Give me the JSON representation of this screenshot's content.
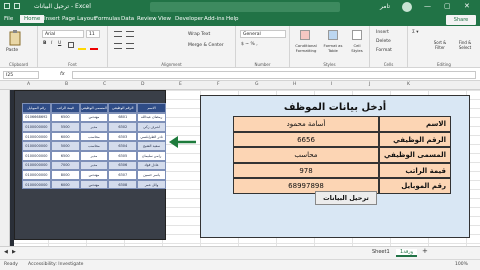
{
  "window": {
    "title_doc": "ترحيل البيانات - Excel",
    "user": "تامر",
    "min": "—",
    "max": "▢",
    "close": "✕"
  },
  "tabs": [
    "File",
    "Home",
    "Insert",
    "Page Layout",
    "Formulas",
    "Data",
    "Review",
    "View",
    "Developer",
    "Add-ins",
    "Help"
  ],
  "share": "Share",
  "ribbon": {
    "clipboard": {
      "paste": "Paste",
      "label": "Clipboard"
    },
    "font": {
      "name": "Arial",
      "size": "11",
      "label": "Font"
    },
    "alignment": {
      "wrap": "Wrap Text",
      "merge": "Merge & Center",
      "label": "Alignment"
    },
    "number": {
      "format": "General",
      "label": "Number"
    },
    "styles": {
      "cond": "Conditional Formatting",
      "table": "Format as Table",
      "cell": "Cell Styles",
      "label": "Styles"
    },
    "cells": {
      "insert": "Insert",
      "delete": "Delete",
      "format": "Format",
      "label": "Cells"
    },
    "editing": {
      "sort": "Sort & Filter",
      "find": "Find & Select",
      "label": "Editing"
    }
  },
  "formula_bar": {
    "namebox": "I25",
    "fx": "fx",
    "content": ""
  },
  "columns": [
    "A",
    "B",
    "C",
    "D",
    "E",
    "F",
    "G",
    "H",
    "I",
    "J",
    "K"
  ],
  "data_table": {
    "headers": [
      "رقم الموبايل",
      "قيمة الراتب",
      "المسمى الوظيفي",
      "الرقم الوظيفي",
      "الاسم"
    ],
    "rows": [
      [
        "0106668692",
        "6500",
        "مهندس",
        "6801",
        "رمضان عبدالله"
      ],
      [
        "0100000000",
        "5500",
        "مدير",
        "6302",
        "اشرف زكي"
      ],
      [
        "0100000000",
        "6000",
        "محاسب",
        "6303",
        "نادر الطرابلسي"
      ],
      [
        "0100000000",
        "5000",
        "محاسب",
        "6304",
        "سعيد الشيخ"
      ],
      [
        "0100000000",
        "6500",
        "مدير",
        "6305",
        "رامي سليمان"
      ],
      [
        "0100000000",
        "7000",
        "مدير",
        "6306",
        "عادل فؤاد"
      ],
      [
        "0100000000",
        "8000",
        "مهندس",
        "6307",
        "ياسر حسين"
      ],
      [
        "0100000000",
        "6000",
        "مهندس",
        "6308",
        "وائل عمر"
      ]
    ]
  },
  "form": {
    "title": "أدخل بيانات الموظف",
    "fields": [
      {
        "label": "الاسم",
        "value": "أسامة محمود"
      },
      {
        "label": "الرقم الوظيفي",
        "value": "6656"
      },
      {
        "label": "المسمى الوظيفي",
        "value": "محاسب"
      },
      {
        "label": "قيمة الراتب",
        "value": "978"
      },
      {
        "label": "رقم الموبايل",
        "value": "68997898"
      }
    ],
    "button": "ترحيل البيانات"
  },
  "sheet_tabs": {
    "sheet1": "Sheet1",
    "sheet2": "ورقة1",
    "add": "+"
  },
  "status": {
    "ready": "Ready",
    "accessibility": "Accessibility: Investigate",
    "zoom": "100%"
  },
  "colors": {
    "accent": "#217346",
    "form_bg": "#d9e7f4",
    "field_bg": "#fcd5b4",
    "table_head": "#2f4c86"
  }
}
